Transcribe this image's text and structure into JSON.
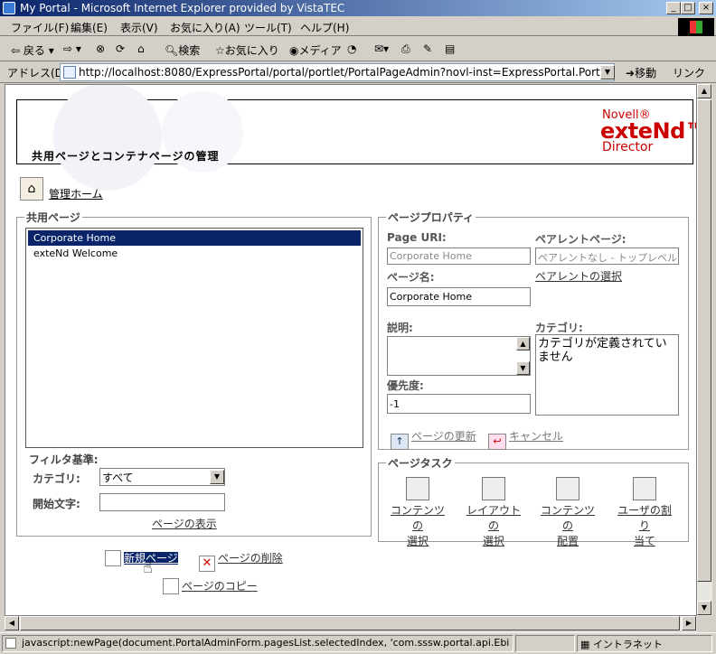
{
  "window": {
    "title": "My Portal - Microsoft Internet Explorer provided by VistaTEC"
  },
  "menu": [
    "ファイル(F)",
    "編集(E)",
    "表示(V)",
    "お気に入り(A)",
    "ツール(T)",
    "ヘルプ(H)"
  ],
  "toolbar": {
    "back": "戻る",
    "search": "検索",
    "favorites": "お気に入り",
    "media": "メディア"
  },
  "address": {
    "label": "アドレス(D)",
    "url": "http://localhost:8080/ExpressPortal/portal/portlet/PortalPageAdmin?novl-inst=ExpressPortal.PortalPageAdmin",
    "go": "移動",
    "links": "リンク"
  },
  "banner": {
    "heading": "共用ページとコンテナページの管理",
    "logo_brand": "Novell®",
    "logo_product": "exteNd™",
    "logo_sub": "Director"
  },
  "home_link": "管理ホーム",
  "shared_pages": {
    "legend": "共用ページ",
    "items": [
      {
        "label": "Corporate Home",
        "selected": true
      },
      {
        "label": "exteNd Welcome",
        "selected": false
      }
    ],
    "filter_label": "フィルタ基準:",
    "category_label": "カテゴリ:",
    "category_value": "すべて",
    "start_label": "開始文字:",
    "start_value": "",
    "show_link": "ページの表示"
  },
  "actions": {
    "new_page": "新規ページ",
    "delete_page": "ページの削除",
    "copy_page": "ページのコピー"
  },
  "props": {
    "legend": "ページプロパティ",
    "uri_label": "Page URI:",
    "uri_value": "Corporate Home",
    "parent_label": "ペアレントページ:",
    "parent_value": "ペアレントなし - トップレベル",
    "name_label": "ページ名:",
    "name_value": "Corporate Home",
    "parent_select_link": "ペアレントの選択",
    "desc_label": "説明:",
    "category_label": "カテゴリ:",
    "category_value": "カテゴリが定義されていません",
    "priority_label": "優先度:",
    "priority_value": "-1",
    "update_link": "ページの更新",
    "cancel_link": "キャンセル"
  },
  "tasks": {
    "legend": "ページタスク",
    "items": [
      {
        "line1": "コンテンツの",
        "line2": "選択"
      },
      {
        "line1": "レイアウトの",
        "line2": "選択"
      },
      {
        "line1": "コンテンツの",
        "line2": "配置"
      },
      {
        "line1": "ユーザの割り",
        "line2": "当て"
      }
    ]
  },
  "status": {
    "text": "javascript:newPage(document.PortalAdminForm.pagesList.selectedIndex, 'com.sssw.portal.api.EbiSharedPag",
    "zone": "イントラネット"
  }
}
